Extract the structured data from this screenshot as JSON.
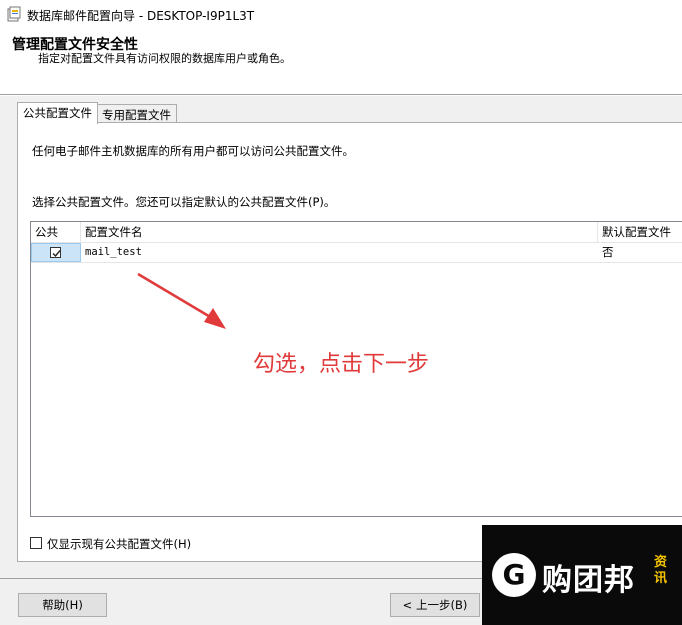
{
  "window": {
    "title": "数据库邮件配置向导 - DESKTOP-I9P1L3T"
  },
  "header": {
    "title": "管理配置文件安全性",
    "subtitle": "指定对配置文件具有访问权限的数据库用户或角色。"
  },
  "tabs": [
    {
      "label": "公共配置文件",
      "active": true
    },
    {
      "label": "专用配置文件",
      "active": false
    }
  ],
  "panel": {
    "description": "任何电子邮件主机数据库的所有用户都可以访问公共配置文件。",
    "select_label": "选择公共配置文件。您还可以指定默认的公共配置文件(P)。"
  },
  "grid": {
    "columns": [
      "公共",
      "配置文件名",
      "默认配置文件"
    ],
    "rows": [
      {
        "public": true,
        "profile_name": "mail_test",
        "default": "否"
      }
    ]
  },
  "annotation": {
    "text": "勾选，点击下一步",
    "color": "#e03a3a"
  },
  "show_existing": {
    "label": "仅显示现有公共配置文件(H)",
    "checked": false
  },
  "footer": {
    "help_label": "帮助(H)",
    "back_label": "< 上一步(B)"
  },
  "watermark": {
    "name": "购团邦",
    "sub": "资讯",
    "logo_letter": "G"
  }
}
